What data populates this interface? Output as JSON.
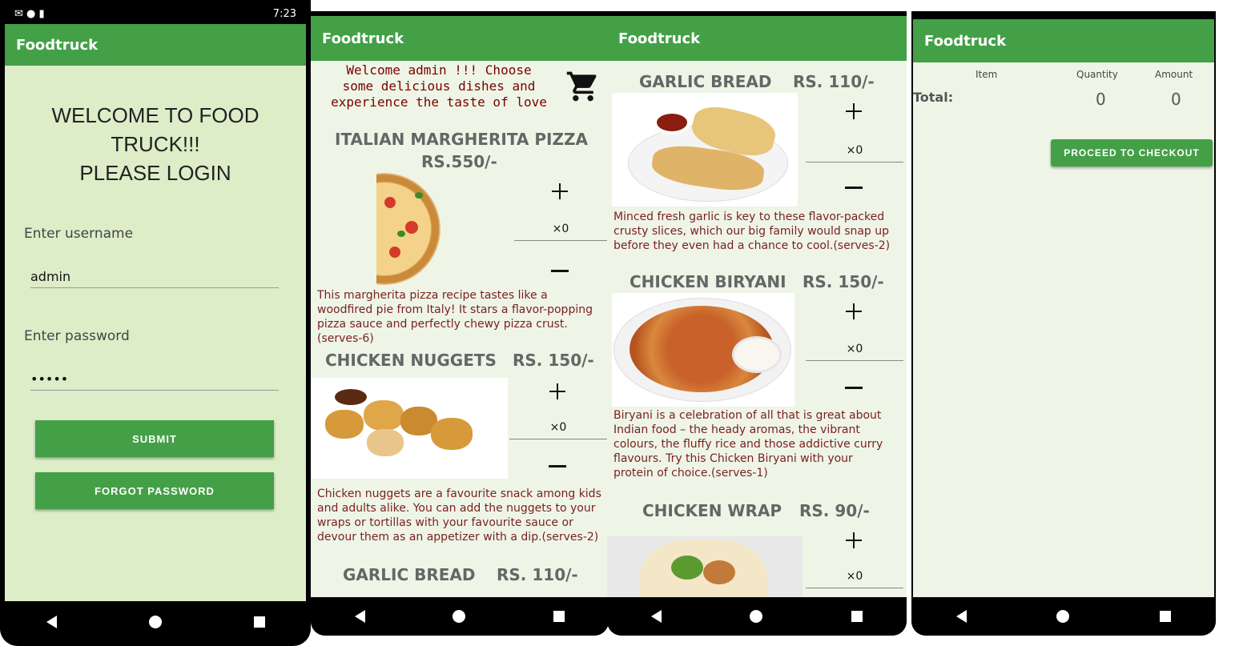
{
  "status": {
    "time": "7:23"
  },
  "app_title": "Foodtruck",
  "login": {
    "heading_line1": "WELCOME TO FOOD TRUCK!!!",
    "heading_line2": "PLEASE LOGIN",
    "username_label": "Enter username",
    "username_value": "admin",
    "password_label": "Enter password",
    "password_value": "•••••",
    "submit_label": "SUBMIT",
    "forgot_label": "FORGOT PASSWORD"
  },
  "menu": {
    "welcome_line1": "Welcome admin !!! Choose",
    "welcome_line2": "some delicious dishes and",
    "welcome_line3": "experience the taste of love",
    "qty_text": "×0",
    "dishes": [
      {
        "name": "ITALIAN MARGHERITA PIZZA",
        "price": "RS.550/-",
        "desc": "This margherita pizza recipe tastes like a woodfired pie from Italy! It stars a flavor-popping pizza sauce and perfectly chewy pizza crust.(serves-6)"
      },
      {
        "name": "CHICKEN NUGGETS",
        "price": "RS. 150/-",
        "desc": "Chicken nuggets are a favourite snack among kids and adults alike. You can add the nuggets to your wraps or tortillas with your favourite sauce or devour them as an appetizer with a dip.(serves-2)"
      },
      {
        "name": "GARLIC BREAD",
        "price": "RS. 110/-",
        "desc": "Minced fresh garlic is key to these flavor-packed crusty slices, which our big family would snap up before they even had a chance to cool.(serves-2)"
      },
      {
        "name": "CHICKEN BIRYANI",
        "price": "RS. 150/-",
        "desc": "Biryani is a celebration of all that is great about Indian food – the heady aromas, the vibrant colours, the fluffy rice and those addictive curry flavours. Try this Chicken Biryani with your protein of choice.(serves-1)"
      },
      {
        "name": "CHICKEN WRAP",
        "price": "RS. 90/-"
      }
    ]
  },
  "cart": {
    "col_item": "Item",
    "col_quantity": "Quantity",
    "col_amount": "Amount",
    "total_label": "Total:",
    "total_quantity": "0",
    "total_amount": "0",
    "checkout_label": "PROCEED TO CHECKOUT"
  },
  "colors": {
    "primary": "#43a047",
    "login_bg": "#dcedc8",
    "menu_bg": "#eef5e6",
    "desc_text": "#7a1f1f"
  },
  "icons": [
    "cart-icon",
    "plus-icon",
    "minus-icon",
    "back-icon",
    "home-icon",
    "recents-icon"
  ]
}
